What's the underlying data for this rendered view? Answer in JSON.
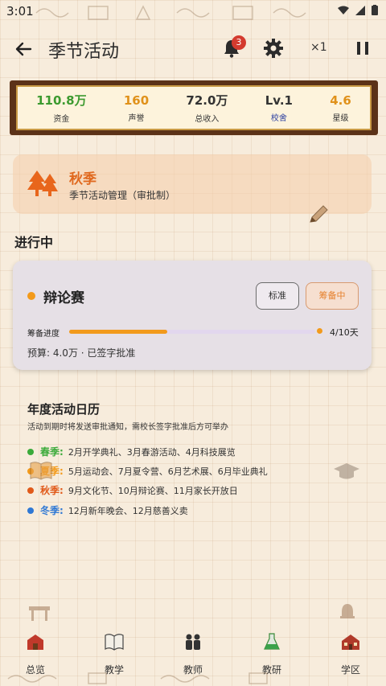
{
  "status": {
    "time": "3:01"
  },
  "header": {
    "title": "季节活动",
    "notification_count": "3",
    "speed": "×1"
  },
  "stats": [
    {
      "value": "110.8万",
      "label": "资金",
      "color": "#3c9a2f",
      "label_color": "#333333"
    },
    {
      "value": "160",
      "label": "声誉",
      "color": "#e0911a",
      "label_color": "#333333"
    },
    {
      "value": "72.0万",
      "label": "总收入",
      "color": "#333333",
      "label_color": "#333333"
    },
    {
      "value": "Lv.1",
      "label": "校舍",
      "color": "#333333",
      "label_color": "#2c3fa0"
    },
    {
      "value": "4.6",
      "label": "星级",
      "color": "#e0911a",
      "label_color": "#333333"
    }
  ],
  "season": {
    "name": "秋季",
    "subtitle": "季节活动管理（审批制）"
  },
  "in_progress": {
    "heading": "进行中"
  },
  "event": {
    "name": "辩论赛",
    "btn_standard": "标准",
    "btn_preparing": "筹备中",
    "progress_label": "筹备进度",
    "progress_fraction": 0.4,
    "progress_text": "4/10天",
    "budget": "预算: 4.0万 · 已签字批准"
  },
  "calendar": {
    "title": "年度活动日历",
    "note": "活动到期时将发送审批通知，需校长签字批准后方可举办",
    "rows": [
      {
        "season": "春季:",
        "text": "2月开学典礼、3月春游活动、4月科技展览",
        "color": "#3aaa3a"
      },
      {
        "season": "夏季:",
        "text": "5月运动会、7月夏令营、6月艺术展、6月毕业典礼",
        "color": "#f39a1a"
      },
      {
        "season": "秋季:",
        "text": "9月文化节、10月辩论赛、11月家长开放日",
        "color": "#e05a1a"
      },
      {
        "season": "冬季:",
        "text": "12月新年晚会、12月慈善义卖",
        "color": "#2f78d4"
      }
    ]
  },
  "nav": [
    {
      "label": "总览",
      "icon": "school-building-icon"
    },
    {
      "label": "教学",
      "icon": "book-icon"
    },
    {
      "label": "教师",
      "icon": "teachers-icon"
    },
    {
      "label": "教研",
      "icon": "flask-icon"
    },
    {
      "label": "学区",
      "icon": "school-house-icon"
    }
  ]
}
